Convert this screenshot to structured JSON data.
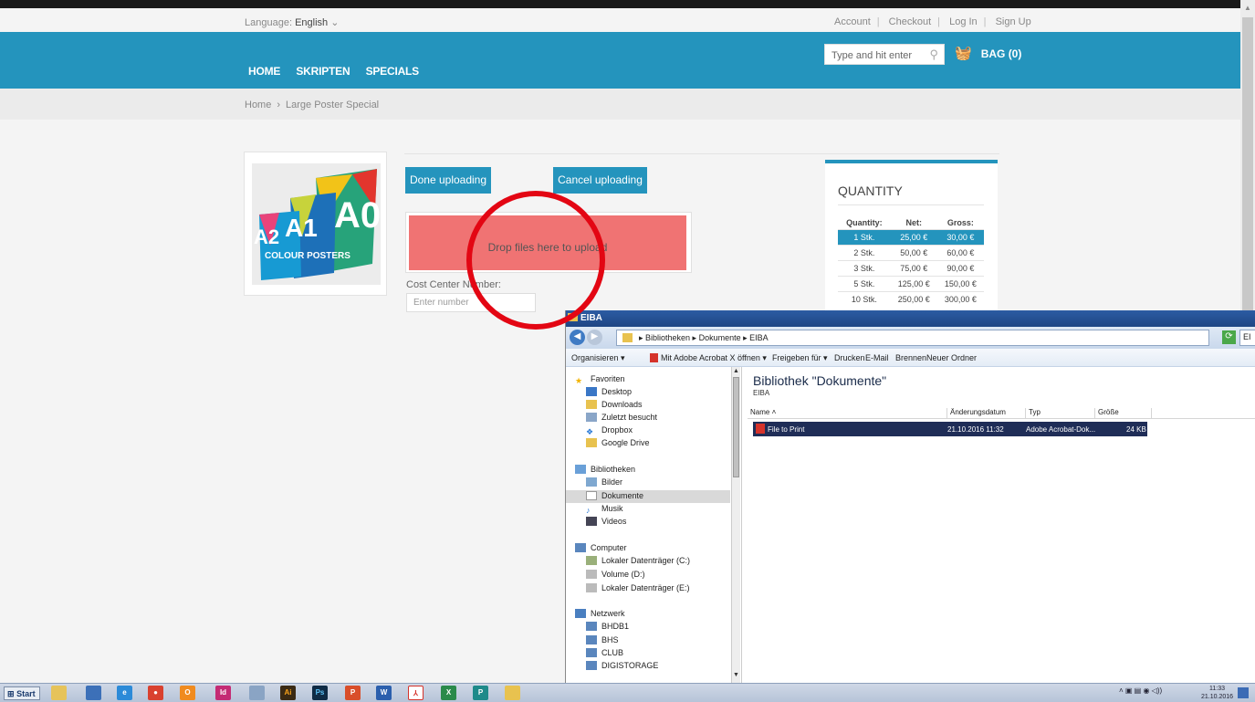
{
  "site": {
    "language_label": "Language:",
    "language_value": "English",
    "account_links": [
      "Account",
      "Checkout",
      "Log In",
      "Sign Up"
    ],
    "nav": [
      "HOME",
      "SKRIPTEN",
      "SPECIALS"
    ],
    "search_placeholder": "Type and hit enter",
    "bag_label": "BAG (0)",
    "breadcrumb": [
      "Home",
      "Large Poster Special"
    ]
  },
  "product": {
    "image_texts": [
      "A2",
      "A1",
      "A0",
      "COLOUR POSTERS"
    ],
    "done_button": "Done uploading",
    "cancel_button": "Cancel uploading",
    "dropzone_text": "Drop files here to upload",
    "cost_center_label": "Cost Center Number:",
    "cost_center_placeholder": "Enter number",
    "quantity": {
      "title": "QUANTITY",
      "headers": [
        "Quantity:",
        "Net:",
        "Gross:"
      ],
      "rows": [
        [
          "1 Stk.",
          "25,00 €",
          "30,00 €"
        ],
        [
          "2 Stk.",
          "50,00 €",
          "60,00 €"
        ],
        [
          "3 Stk.",
          "75,00 €",
          "90,00 €"
        ],
        [
          "5 Stk.",
          "125,00 €",
          "150,00 €"
        ],
        [
          "10 Stk.",
          "250,00 €",
          "300,00 €"
        ]
      ],
      "selected_row": 0
    }
  },
  "explorer": {
    "title": "EIBA",
    "path": "▸ Bibliotheken ▸ Dokumente ▸ EIBA",
    "search_partial": "EI",
    "toolbar": [
      "Organisieren ▾",
      "Mit Adobe Acrobat X öffnen ▾",
      "Freigeben für ▾",
      "Drucken",
      "E-Mail",
      "Brennen",
      "Neuer Ordner"
    ],
    "nav_groups": [
      {
        "header": "Favoriten",
        "items": [
          "Desktop",
          "Downloads",
          "Zuletzt besucht",
          "Dropbox",
          "Google Drive"
        ]
      },
      {
        "header": "Bibliotheken",
        "items": [
          "Bilder",
          "Dokumente",
          "Musik",
          "Videos"
        ]
      },
      {
        "header": "Computer",
        "items": [
          "Lokaler Datenträger (C:)",
          "Volume (D:)",
          "Lokaler Datenträger (E:)"
        ]
      },
      {
        "header": "Netzwerk",
        "items": [
          "BHDB1",
          "BHS",
          "CLUB",
          "DIGISTORAGE"
        ]
      }
    ],
    "selected_nav": "Dokumente",
    "library_title": "Bibliothek \"Dokumente\"",
    "library_subtitle": "EIBA",
    "columns": [
      "Name",
      "Änderungsdatum",
      "Typ",
      "Größe"
    ],
    "files": [
      {
        "name": "File to Print",
        "date": "21.10.2016 11:32",
        "type": "Adobe Acrobat-Dok...",
        "size": "24 KB"
      }
    ]
  },
  "taskbar": {
    "start": "Start",
    "apps": [
      "explorer",
      "network",
      "internet-explorer",
      "chrome",
      "outlook",
      "indesign",
      "calculator",
      "illustrator",
      "photoshop",
      "powerpoint",
      "word",
      "acrobat",
      "excel",
      "publisher",
      "folder"
    ],
    "clock_time": "11:33",
    "clock_date": "21.10.2016"
  },
  "colors": {
    "brand": "#2494bd",
    "dropzone": "#f07373",
    "annotation_circle": "#e30613",
    "selected_file": "#1f2d57"
  }
}
